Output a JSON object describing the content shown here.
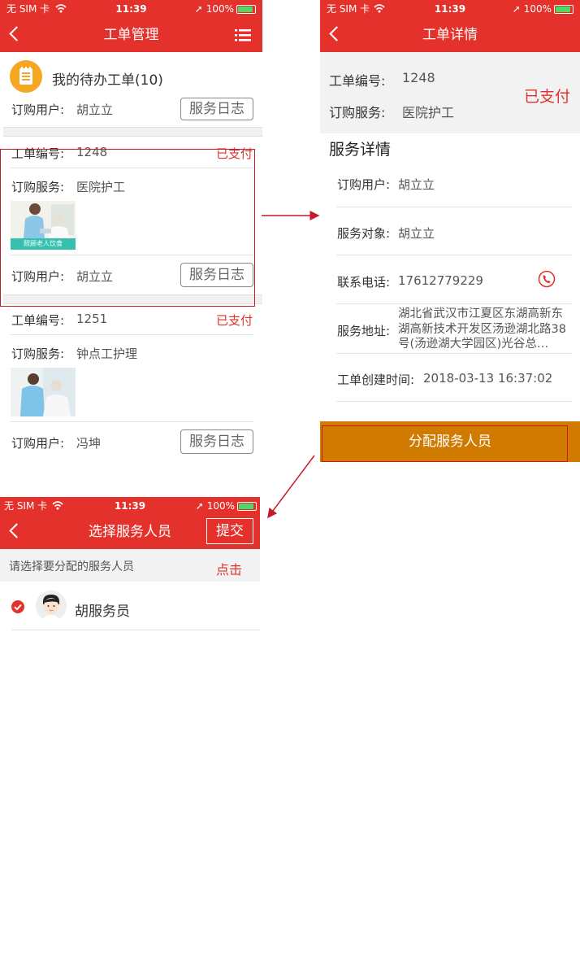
{
  "status": {
    "carrier": "无 SIM 卡",
    "time": "11:39",
    "battery": "100%"
  },
  "screen1": {
    "title": "工单管理",
    "pending": "我的待办工单(10)",
    "top_row": {
      "user_label": "订购用户:",
      "user": "胡立立",
      "log_button": "服务日志"
    },
    "orders": [
      {
        "no_label": "工单编号:",
        "no": "1248",
        "status": "已支付",
        "svc_label": "订购服务:",
        "svc": "医院护工",
        "thumb_caption": "照顾老人饮食",
        "user_label": "订购用户:",
        "user": "胡立立",
        "log_button": "服务日志"
      },
      {
        "no_label": "工单编号:",
        "no": "1251",
        "status": "已支付",
        "svc_label": "订购服务:",
        "svc": "钟点工护理",
        "user_label": "订购用户:",
        "user": "冯坤",
        "log_button": "服务日志"
      }
    ]
  },
  "screen2": {
    "title": "工单详情",
    "no_label": "工单编号:",
    "no": "1248",
    "svc_label": "订购服务:",
    "svc": "医院护工",
    "status": "已支付",
    "section": "服务详情",
    "details": [
      {
        "label": "订购用户:",
        "value": "胡立立"
      },
      {
        "label": "服务对象:",
        "value": "胡立立"
      },
      {
        "label": "联系电话:",
        "value": "17612779229"
      },
      {
        "label": "服务地址:",
        "value": "湖北省武汉市江夏区东湖高新东湖高新技术开发区汤逊湖北路38号(汤逊湖大学园区)光谷总…"
      },
      {
        "label": "工单创建时间:",
        "value": "2018-03-13 16:37:02"
      }
    ],
    "assign_button": "分配服务人员"
  },
  "screen3": {
    "title": "选择服务人员",
    "submit": "提交",
    "hint": "请选择要分配的服务人员",
    "click_note": "点击",
    "staff": [
      {
        "name": "胡服务员",
        "selected": true
      }
    ]
  },
  "colors": {
    "brand_red": "#e5312b",
    "assign_orange": "#d17a00",
    "pending_icon": "#f5a623",
    "annotation": "#c41a2c"
  },
  "icons": [
    "back-icon",
    "list-menu-icon",
    "notepad-icon",
    "phone-icon",
    "checkmark-icon",
    "avatar-icon",
    "wifi-icon",
    "battery-icon",
    "location-arrow-icon"
  ]
}
